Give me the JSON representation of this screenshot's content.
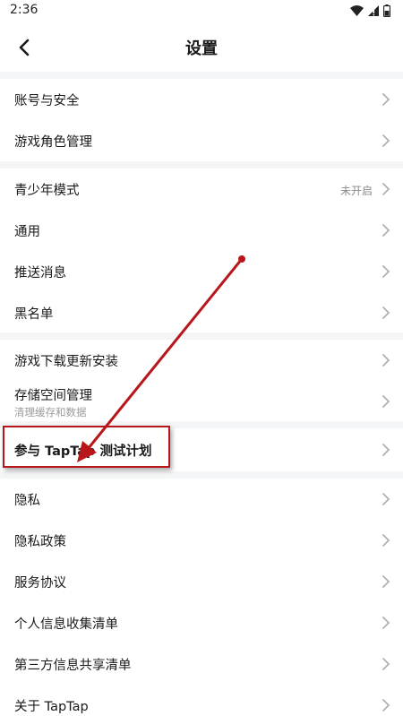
{
  "status_bar": {
    "time": "2:36",
    "icons": [
      "wifi-icon",
      "signal-icon",
      "battery-icon"
    ]
  },
  "header": {
    "title": "设置",
    "back_icon": "back-arrow-icon"
  },
  "groups": [
    {
      "items": [
        {
          "label": "账号与安全"
        },
        {
          "label": "游戏角色管理"
        }
      ]
    },
    {
      "items": [
        {
          "label": "青少年模式",
          "value": "未开启"
        },
        {
          "label": "通用"
        },
        {
          "label": "推送消息"
        },
        {
          "label": "黑名单"
        }
      ]
    },
    {
      "items": [
        {
          "label": "游戏下载更新安装"
        },
        {
          "label": "存储空间管理",
          "sub": "清理缓存和数据"
        }
      ]
    },
    {
      "items": [
        {
          "label": "参与 TapTap 测试计划",
          "highlighted": true
        }
      ]
    },
    {
      "items": [
        {
          "label": "隐私"
        },
        {
          "label": "隐私政策"
        },
        {
          "label": "服务协议"
        },
        {
          "label": "个人信息收集清单"
        },
        {
          "label": "第三方信息共享清单"
        },
        {
          "label": "关于 TapTap"
        }
      ]
    }
  ],
  "annotation": {
    "arrow_color": "#b8161b",
    "icon": "red-arrow-icon"
  },
  "colors": {
    "accent_red": "#b8161b",
    "divider": "#f4f5f6",
    "chevron": "#b0b0b0"
  }
}
